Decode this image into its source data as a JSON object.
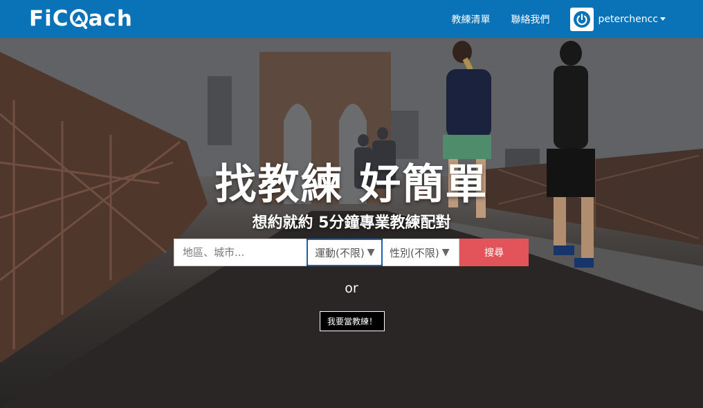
{
  "brand": {
    "logo_text_left": "FiC",
    "logo_text_right": "ach",
    "colors": {
      "navbar": "#0a72b6",
      "search_button": "#e2545a",
      "select_focus": "#1a5fb4"
    }
  },
  "nav": {
    "links": [
      "教練清單",
      "聯絡我們"
    ],
    "user": {
      "name": "peterchencc",
      "avatar_icon": "power-icon"
    }
  },
  "hero": {
    "headline": "找教練 好簡單",
    "subline": "想約就約 5分鐘專業教練配對",
    "search": {
      "location_placeholder": "地區、城市...",
      "sport_value": "運動(不限)",
      "gender_value": "性別(不限)",
      "submit_label": "搜尋"
    },
    "or_text": "or",
    "coach_cta": "我要當教練！"
  }
}
